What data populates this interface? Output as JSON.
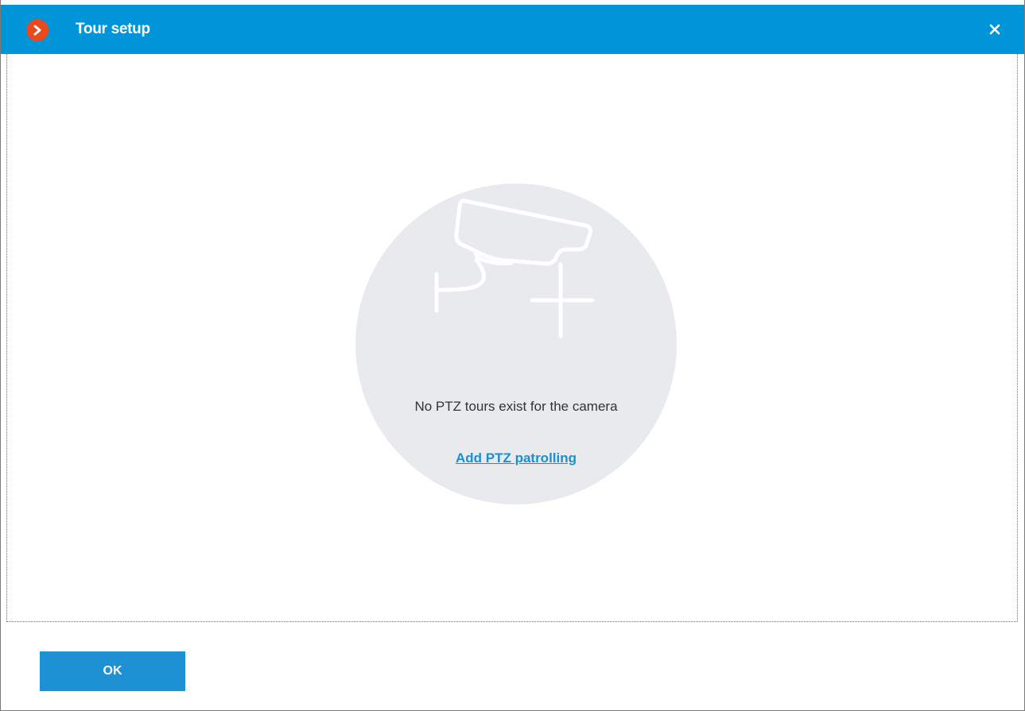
{
  "window": {
    "title": "Tour setup",
    "app_icon": "chevron-right-icon",
    "close_icon": "close-icon"
  },
  "empty_state": {
    "icon": "ptz-camera-add-icon",
    "message": "No PTZ tours exist for the camera",
    "link_label": "Add PTZ patrolling"
  },
  "footer": {
    "ok_label": "OK"
  },
  "colors": {
    "title_bar": "#0095d9",
    "app_icon": "#e8491d",
    "link": "#1a8fd4",
    "ok_button": "#1e90d4",
    "placeholder_bg": "#e8eaee"
  }
}
